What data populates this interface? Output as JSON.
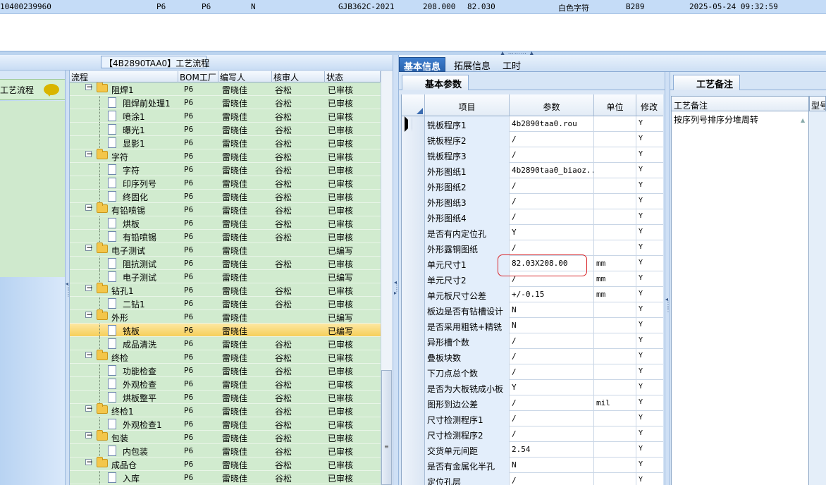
{
  "top_row": {
    "id": "10400239960",
    "c2": "P6",
    "c3": "P6",
    "c4": "N",
    "standard": "GJB362C-2021",
    "v1": "208.000",
    "v2": "82.030",
    "char_color": "白色字符",
    "code": "B289",
    "datetime": "2025-05-24 09:32:59"
  },
  "left_panel": {
    "title": "【4B2890TAA0】工艺流程",
    "nav_item": "工艺流程",
    "headers": [
      "流程",
      "BOM工厂",
      "编写人",
      "核审人",
      "状态"
    ],
    "rows": [
      {
        "level": 0,
        "name": "阻焊1",
        "factory": "P6",
        "writer": "雷晓佳",
        "reviewer": "谷松",
        "status": "已审核"
      },
      {
        "level": 1,
        "name": "阻焊前处理1",
        "factory": "P6",
        "writer": "雷晓佳",
        "reviewer": "谷松",
        "status": "已审核"
      },
      {
        "level": 1,
        "name": "喷涂1",
        "factory": "P6",
        "writer": "雷晓佳",
        "reviewer": "谷松",
        "status": "已审核"
      },
      {
        "level": 1,
        "name": "曝光1",
        "factory": "P6",
        "writer": "雷晓佳",
        "reviewer": "谷松",
        "status": "已审核"
      },
      {
        "level": 1,
        "name": "显影1",
        "factory": "P6",
        "writer": "雷晓佳",
        "reviewer": "谷松",
        "status": "已审核"
      },
      {
        "level": 0,
        "name": "字符",
        "factory": "P6",
        "writer": "雷晓佳",
        "reviewer": "谷松",
        "status": "已审核"
      },
      {
        "level": 1,
        "name": "字符",
        "factory": "P6",
        "writer": "雷晓佳",
        "reviewer": "谷松",
        "status": "已审核"
      },
      {
        "level": 1,
        "name": "印序列号",
        "factory": "P6",
        "writer": "雷晓佳",
        "reviewer": "谷松",
        "status": "已审核"
      },
      {
        "level": 1,
        "name": "终固化",
        "factory": "P6",
        "writer": "雷晓佳",
        "reviewer": "谷松",
        "status": "已审核"
      },
      {
        "level": 0,
        "name": "有铅喷锡",
        "factory": "P6",
        "writer": "雷晓佳",
        "reviewer": "谷松",
        "status": "已审核"
      },
      {
        "level": 1,
        "name": "烘板",
        "factory": "P6",
        "writer": "雷晓佳",
        "reviewer": "谷松",
        "status": "已审核"
      },
      {
        "level": 1,
        "name": "有铅喷锡",
        "factory": "P6",
        "writer": "雷晓佳",
        "reviewer": "谷松",
        "status": "已审核"
      },
      {
        "level": 0,
        "name": "电子测试",
        "factory": "P6",
        "writer": "雷晓佳",
        "reviewer": "",
        "status": "已编写"
      },
      {
        "level": 1,
        "name": "阻抗测试",
        "factory": "P6",
        "writer": "雷晓佳",
        "reviewer": "谷松",
        "status": "已审核"
      },
      {
        "level": 1,
        "name": "电子测试",
        "factory": "P6",
        "writer": "雷晓佳",
        "reviewer": "",
        "status": "已编写"
      },
      {
        "level": 0,
        "name": "钻孔1",
        "factory": "P6",
        "writer": "雷晓佳",
        "reviewer": "谷松",
        "status": "已审核"
      },
      {
        "level": 1,
        "name": "二钻1",
        "factory": "P6",
        "writer": "雷晓佳",
        "reviewer": "谷松",
        "status": "已审核"
      },
      {
        "level": 0,
        "name": "外形",
        "factory": "P6",
        "writer": "雷晓佳",
        "reviewer": "",
        "status": "已编写"
      },
      {
        "level": 1,
        "name": "铣板",
        "factory": "P6",
        "writer": "雷晓佳",
        "reviewer": "",
        "status": "已编写",
        "selected": true
      },
      {
        "level": 1,
        "name": "成品清洗",
        "factory": "P6",
        "writer": "雷晓佳",
        "reviewer": "谷松",
        "status": "已审核"
      },
      {
        "level": 0,
        "name": "终检",
        "factory": "P6",
        "writer": "雷晓佳",
        "reviewer": "谷松",
        "status": "已审核"
      },
      {
        "level": 1,
        "name": "功能检查",
        "factory": "P6",
        "writer": "雷晓佳",
        "reviewer": "谷松",
        "status": "已审核"
      },
      {
        "level": 1,
        "name": "外观检查",
        "factory": "P6",
        "writer": "雷晓佳",
        "reviewer": "谷松",
        "status": "已审核"
      },
      {
        "level": 1,
        "name": "烘板整平",
        "factory": "P6",
        "writer": "雷晓佳",
        "reviewer": "谷松",
        "status": "已审核"
      },
      {
        "level": 0,
        "name": "终检1",
        "factory": "P6",
        "writer": "雷晓佳",
        "reviewer": "谷松",
        "status": "已审核"
      },
      {
        "level": 1,
        "name": "外观检查1",
        "factory": "P6",
        "writer": "雷晓佳",
        "reviewer": "谷松",
        "status": "已审核"
      },
      {
        "level": 0,
        "name": "包装",
        "factory": "P6",
        "writer": "雷晓佳",
        "reviewer": "谷松",
        "status": "已审核"
      },
      {
        "level": 1,
        "name": "内包装",
        "factory": "P6",
        "writer": "雷晓佳",
        "reviewer": "谷松",
        "status": "已审核"
      },
      {
        "level": 0,
        "name": "成品仓",
        "factory": "P6",
        "writer": "雷晓佳",
        "reviewer": "谷松",
        "status": "已审核"
      },
      {
        "level": 1,
        "name": "入库",
        "factory": "P6",
        "writer": "雷晓佳",
        "reviewer": "谷松",
        "status": "已审核"
      }
    ]
  },
  "tabs": [
    "基本信息",
    "拓展信息",
    "工时"
  ],
  "params": {
    "sub_tab": "基本参数",
    "headers": [
      "项目",
      "参数",
      "单位",
      "修改"
    ],
    "rows": [
      {
        "name": "铣板程序1",
        "value": "4b2890taa0.rou",
        "unit": "",
        "mod": "Y",
        "current": true
      },
      {
        "name": "铣板程序2",
        "value": "/",
        "unit": "",
        "mod": "Y"
      },
      {
        "name": "铣板程序3",
        "value": "/",
        "unit": "",
        "mod": "Y"
      },
      {
        "name": "外形图纸1",
        "value": "4b2890taa0_biaoz...",
        "unit": "",
        "mod": "Y"
      },
      {
        "name": "外形图纸2",
        "value": "/",
        "unit": "",
        "mod": "Y"
      },
      {
        "name": "外形图纸3",
        "value": "/",
        "unit": "",
        "mod": "Y"
      },
      {
        "name": "外形图纸4",
        "value": "/",
        "unit": "",
        "mod": "Y"
      },
      {
        "name": "是否有内定位孔",
        "value": "Y",
        "unit": "",
        "mod": "Y"
      },
      {
        "name": "外形露铜图纸",
        "value": "/",
        "unit": "",
        "mod": "Y"
      },
      {
        "name": "单元尺寸1",
        "value": "82.03X208.00",
        "unit": "mm",
        "mod": "Y"
      },
      {
        "name": "单元尺寸2",
        "value": "/",
        "unit": "mm",
        "mod": "Y"
      },
      {
        "name": "单元板尺寸公差",
        "value": "+/-0.15",
        "unit": "mm",
        "mod": "Y"
      },
      {
        "name": "板边是否有钻槽设计",
        "value": "N",
        "unit": "",
        "mod": "Y"
      },
      {
        "name": "是否采用粗铣+精铣",
        "value": "N",
        "unit": "",
        "mod": "Y"
      },
      {
        "name": "异形槽个数",
        "value": "/",
        "unit": "",
        "mod": "Y"
      },
      {
        "name": "叠板块数",
        "value": "/",
        "unit": "",
        "mod": "Y"
      },
      {
        "name": "下刀点总个数",
        "value": "/",
        "unit": "",
        "mod": "Y"
      },
      {
        "name": "是否为大板铣成小板",
        "value": "Y",
        "unit": "",
        "mod": "Y"
      },
      {
        "name": "图形到边公差",
        "value": "/",
        "unit": "mil",
        "mod": "Y"
      },
      {
        "name": "尺寸检测程序1",
        "value": "/",
        "unit": "",
        "mod": "Y"
      },
      {
        "name": "尺寸检测程序2",
        "value": "/",
        "unit": "",
        "mod": "Y"
      },
      {
        "name": "交货单元间距",
        "value": "2.54",
        "unit": "",
        "mod": "Y"
      },
      {
        "name": "是否有金属化半孔",
        "value": "N",
        "unit": "",
        "mod": "Y"
      },
      {
        "name": "定位孔层",
        "value": "/",
        "unit": "",
        "mod": "Y"
      }
    ]
  },
  "notes": {
    "tab": "工艺备注",
    "header": "工艺备注",
    "text": "按序列号排序分堆周转",
    "type_header": "型号"
  },
  "colors": {
    "tree_bg": "#d1ebcf",
    "selected_row": "#f6cf5a",
    "active_tab": "#2a63ad",
    "highlight_box": "#d9262a"
  }
}
